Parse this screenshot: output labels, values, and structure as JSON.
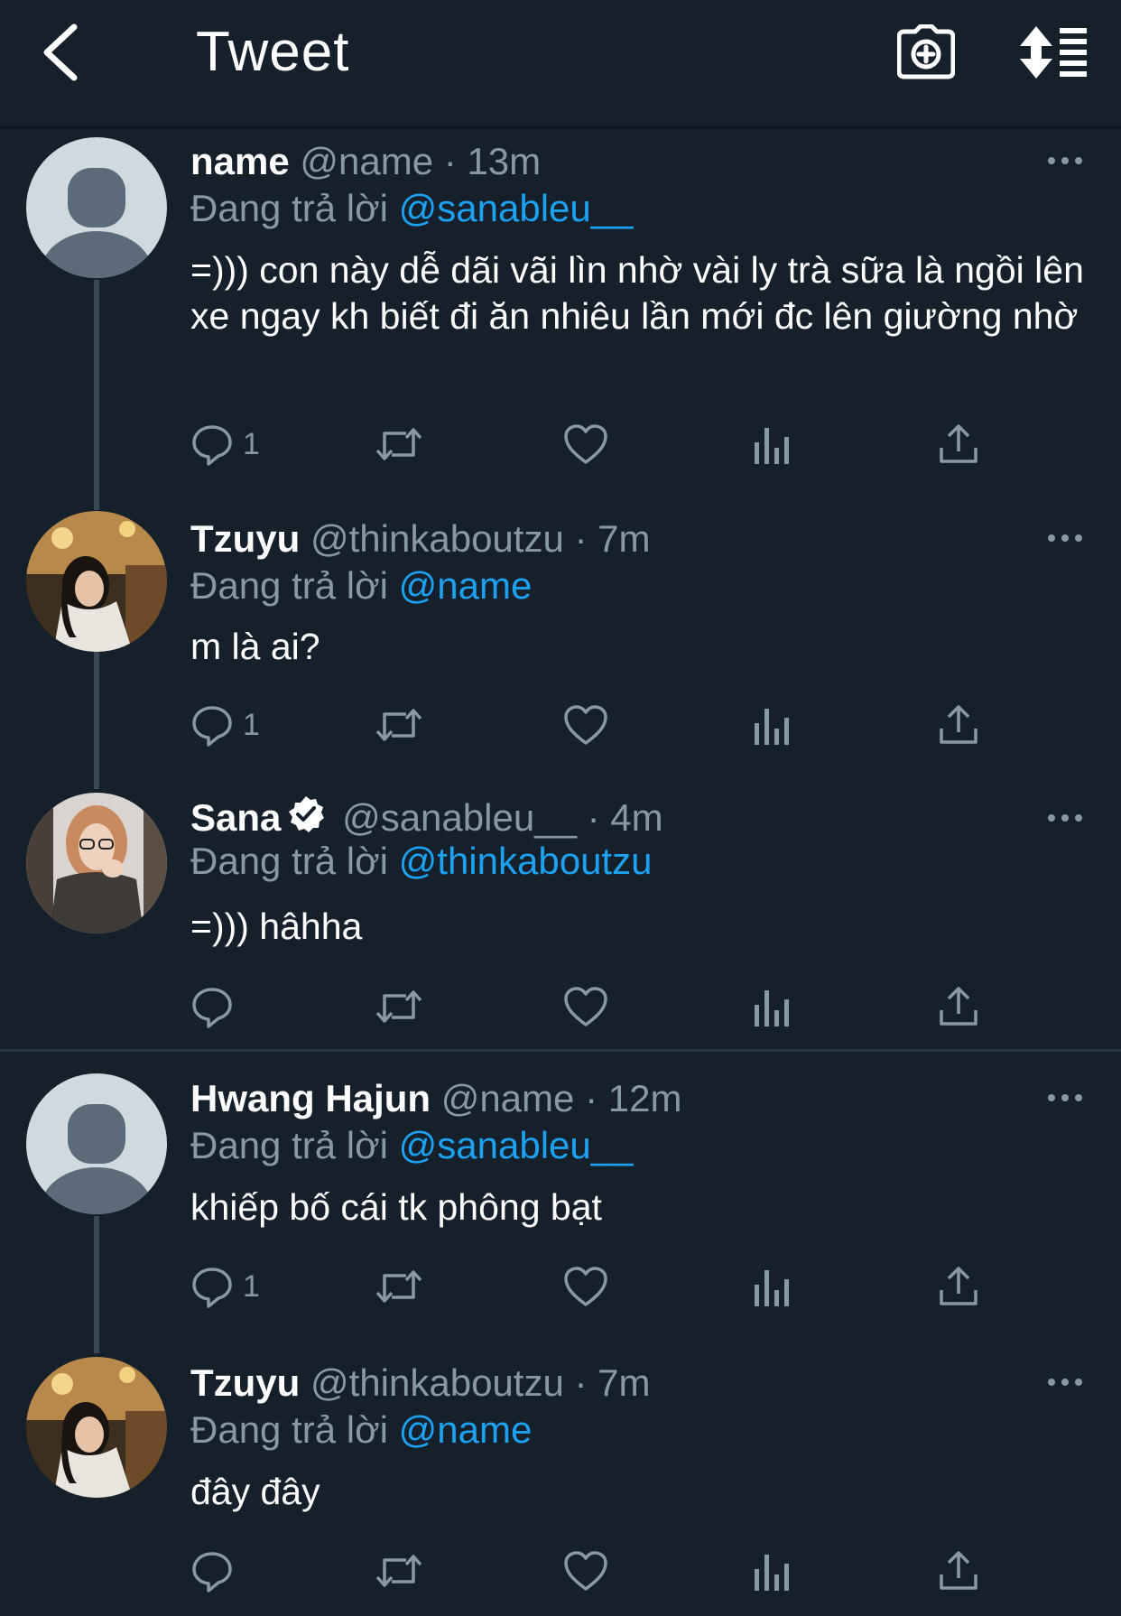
{
  "header": {
    "title": "Tweet"
  },
  "icons": {
    "back": "chevron-left-icon",
    "camera": "camera-add-icon",
    "sort": "sort-icon",
    "more": "more-icon",
    "reply": "reply-icon",
    "retweet": "retweet-icon",
    "like": "heart-icon",
    "analytics": "analytics-icon",
    "share": "share-icon"
  },
  "colors": {
    "background": "#15202b",
    "mention": "#1da1f2",
    "secondary_text": "#8899a6"
  },
  "tweets": [
    {
      "display_name": "name",
      "handle": "@name",
      "separator": "·",
      "time": "13m",
      "reply_prefix": "Đang trả lời",
      "reply_to": "@sanableu__",
      "text": "=))) con này dễ dãi vãi lìn nhờ vài ly trà sữa là ngồi lên xe ngay kh biết đi ăn nhiêu lần mới đc lên giường nhờ",
      "reply_count": "1",
      "verified": false
    },
    {
      "display_name": "Tzuyu",
      "handle": "@thinkaboutzu",
      "separator": "·",
      "time": "7m",
      "reply_prefix": "Đang trả lời",
      "reply_to": "@name",
      "text": "m là ai?",
      "reply_count": "1",
      "verified": false
    },
    {
      "display_name": "Sana",
      "handle": "@sanableu__",
      "separator": "·",
      "time": "4m",
      "reply_prefix": "Đang trả lời",
      "reply_to": "@thinkaboutzu",
      "text": "=))) hâhha",
      "reply_count": "",
      "verified": true
    },
    {
      "display_name": "Hwang Hajun",
      "handle": "@name",
      "separator": "·",
      "time": "12m",
      "reply_prefix": "Đang trả lời",
      "reply_to": "@sanableu__",
      "text": "khiếp bố cái tk phông bạt",
      "reply_count": "1",
      "verified": false
    },
    {
      "display_name": "Tzuyu",
      "handle": "@thinkaboutzu",
      "separator": "·",
      "time": "7m",
      "reply_prefix": "Đang trả lời",
      "reply_to": "@name",
      "text": "đây đây",
      "reply_count": "",
      "verified": false
    }
  ]
}
